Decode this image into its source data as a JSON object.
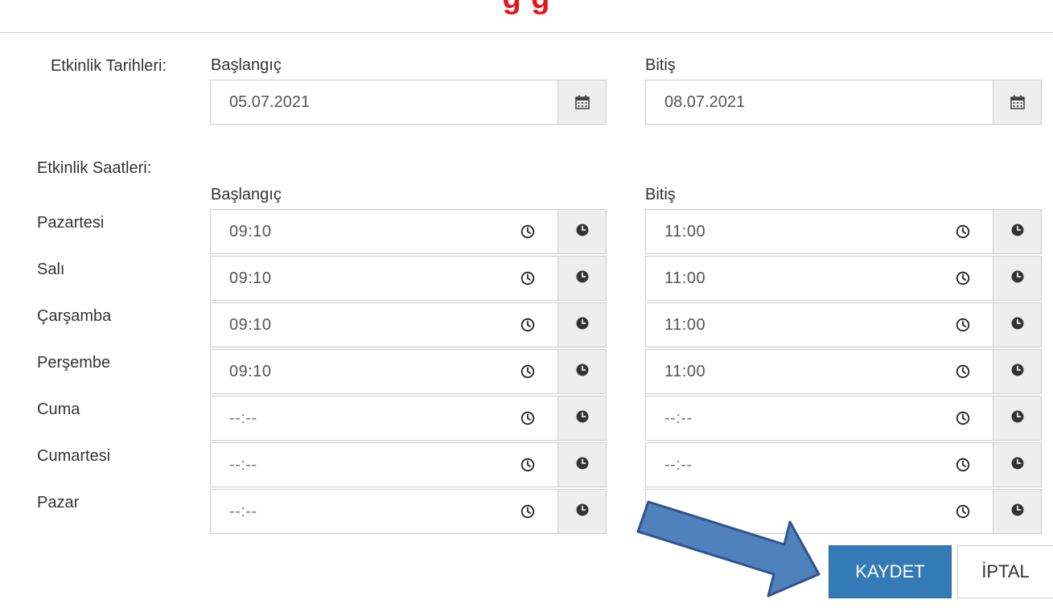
{
  "header": {
    "title_partial": "g                                   g"
  },
  "dates": {
    "label": "Etkinlik Tarihleri:",
    "start": {
      "label": "Başlangıç",
      "value": "05.07.2021",
      "icon": "calendar-icon"
    },
    "end": {
      "label": "Bitiş",
      "value": "08.07.2021",
      "icon": "calendar-icon"
    }
  },
  "hours": {
    "label": "Etkinlik Saatleri:",
    "start_label": "Başlangıç",
    "end_label": "Bitiş",
    "days": [
      {
        "name": "Pazartesi",
        "start": "09:10",
        "end": "11:00"
      },
      {
        "name": "Salı",
        "start": "09:10",
        "end": "11:00"
      },
      {
        "name": "Çarşamba",
        "start": "09:10",
        "end": "11:00"
      },
      {
        "name": "Perşembe",
        "start": "09:10",
        "end": "11:00"
      },
      {
        "name": "Cuma",
        "start": "--:--",
        "end": "--:--"
      },
      {
        "name": "Cumartesi",
        "start": "--:--",
        "end": "--:--"
      },
      {
        "name": "Pazar",
        "start": "--:--",
        "end": ""
      }
    ]
  },
  "actions": {
    "save_label": "KAYDET",
    "cancel_label": "İPTAL"
  },
  "colors": {
    "accent": "#337ab7",
    "title_red": "#e8141b",
    "arrow_fill": "#4f81bd",
    "arrow_stroke": "#2f528f"
  }
}
